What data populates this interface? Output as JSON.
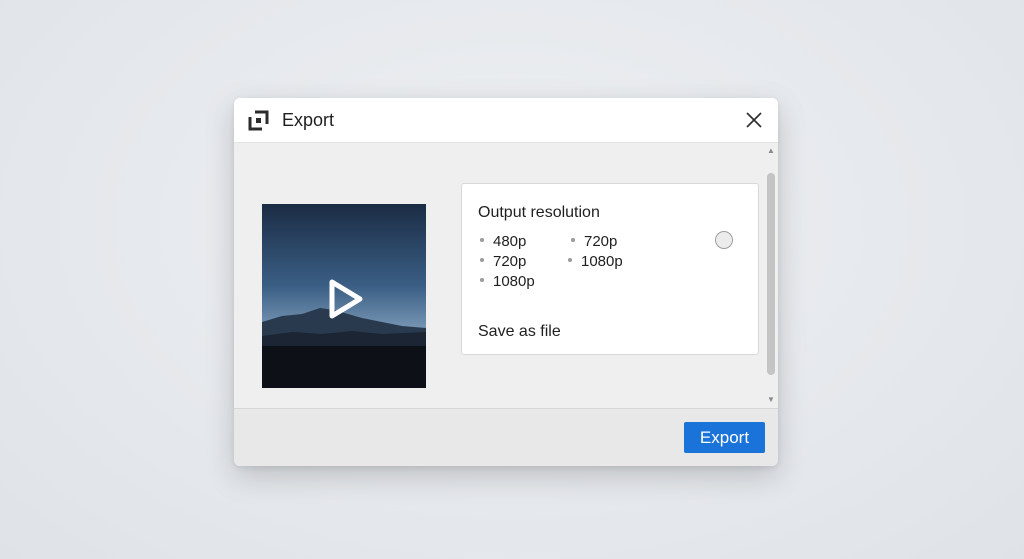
{
  "dialog": {
    "title": "Export",
    "app_icon": "export-frame-icon",
    "close_icon": "close-icon"
  },
  "preview": {
    "icon": "play-icon"
  },
  "settings": {
    "heading": "Output resolution",
    "options_left": [
      "480p",
      "720p",
      "1080p"
    ],
    "options_right": [
      "720p",
      "1080p"
    ],
    "save_label": "Save as file"
  },
  "footer": {
    "export_label": "Export"
  },
  "colors": {
    "accent": "#1a73d9"
  }
}
